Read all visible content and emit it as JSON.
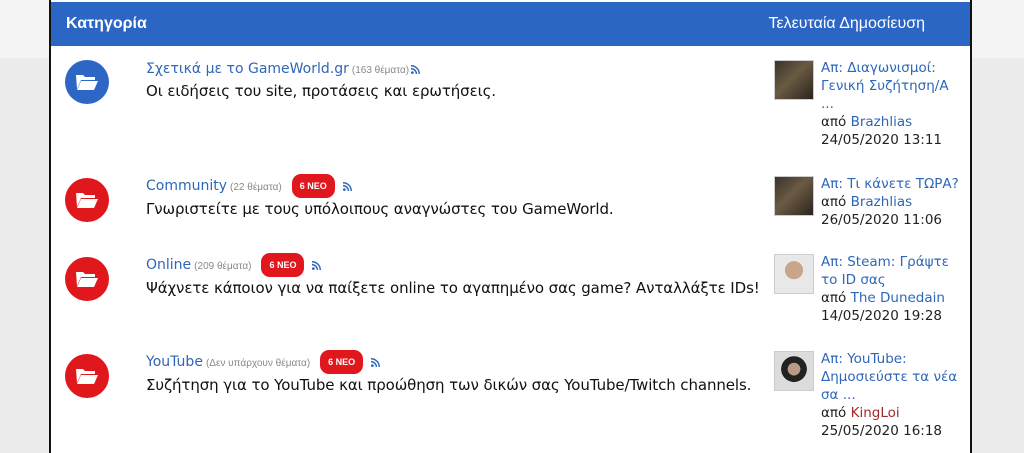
{
  "header": {
    "category_label": "Κατηγορία",
    "last_post_label": "Τελευταία Δημοσίευση"
  },
  "forums": [
    {
      "title": "Σχετικά με το GameWorld.gr",
      "count": "(163 θέματα)",
      "new_badge": "",
      "description": "Οι ειδήσεις του site, προτάσεις και ερωτήσεις.",
      "icon_color": "#2e66c6",
      "last_topic": "Απ: Διαγωνισμοί: Γενική Συζήτηση/Α ...",
      "by_label": "από",
      "last_user": "Brazhlias",
      "last_date": "24/05/2020 13:11"
    },
    {
      "title": "Community",
      "count": "(22 θέματα)",
      "new_badge": "6 ΝΕΟ",
      "description": "Γνωριστείτε με τους υπόλοιπους αναγνώστες του GameWorld.",
      "icon_color": "#e1171e",
      "last_topic": "Απ: Τι κάνετε ΤΩΡΑ?",
      "by_label": "από",
      "last_user": "Brazhlias",
      "last_date": "26/05/2020 11:06"
    },
    {
      "title": "Online",
      "count": "(209 θέματα)",
      "new_badge": "6 ΝΕΟ",
      "description": "Ψάχνετε κάποιον για να παίξετε online το αγαπημένο σας game? Ανταλλάξτε IDs!",
      "icon_color": "#e1171e",
      "last_topic": "Απ: Steam: Γράψτε το ID σας",
      "by_label": "από",
      "last_user": "The Dunedain",
      "last_date": "14/05/2020 19:28"
    },
    {
      "title": "YouTube",
      "count": "(Δεν υπάρχουν θέματα)",
      "new_badge": "6 ΝΕΟ",
      "description": "Συζήτηση για το YouTube και προώθηση των δικών σας YouTube/Twitch channels.",
      "icon_color": "#e1171e",
      "last_topic": "Απ: YouTube: Δημοσιεύστε τα νέα σα ...",
      "by_label": "από",
      "last_user": "KingLoi",
      "last_date": "25/05/2020 16:18"
    }
  ]
}
